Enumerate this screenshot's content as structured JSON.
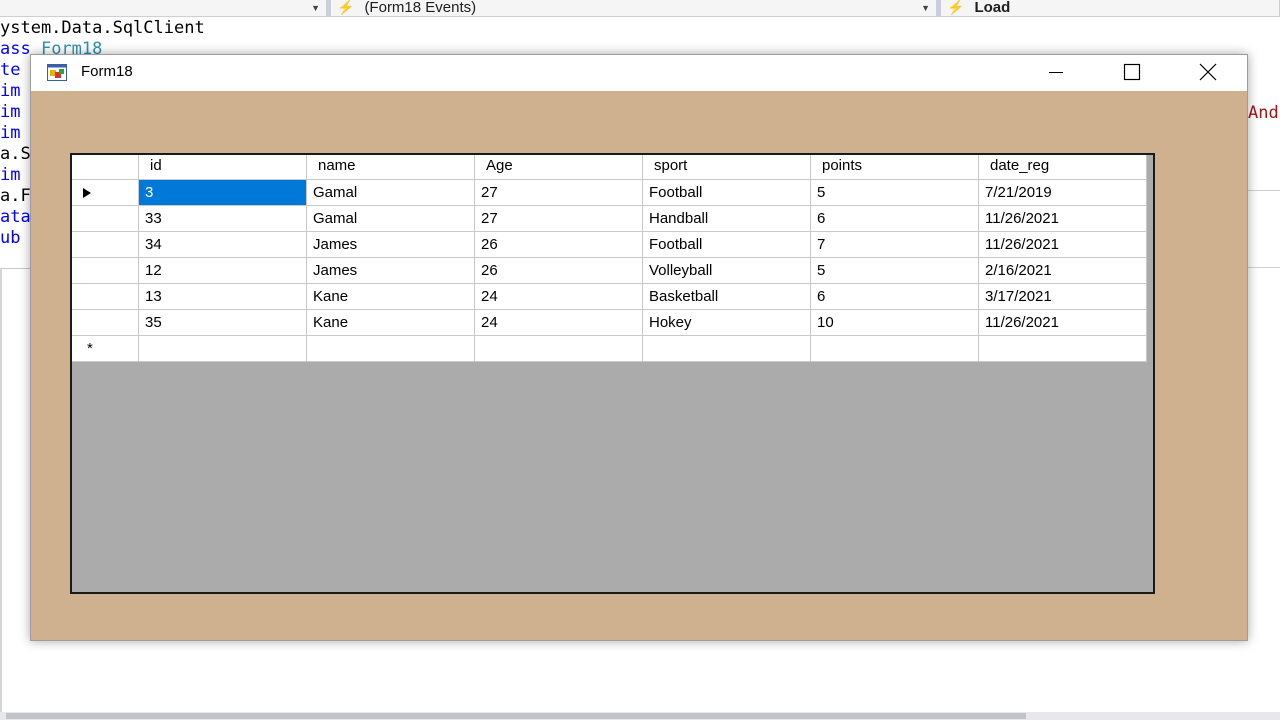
{
  "ide": {
    "member_dropdown": "(Form18 Events)",
    "event_dropdown": "Load",
    "code_lines": [
      [
        "ystem.Data.SqlClient"
      ],
      [
        "ass",
        " Form18"
      ],
      [
        "te"
      ],
      [
        "im"
      ],
      [
        "im"
      ],
      [
        "im"
      ],
      [
        "a.S"
      ],
      [
        "im"
      ],
      [
        "a.F"
      ],
      [
        "ata"
      ],
      [
        "ub"
      ]
    ],
    "code_right_fragment": "And"
  },
  "window": {
    "title": "Form18"
  },
  "grid": {
    "columns": [
      "id",
      "name",
      "Age",
      "sport",
      "points",
      "date_reg"
    ],
    "rows": [
      [
        "3",
        "Gamal",
        "27",
        "Football",
        "5",
        "7/21/2019"
      ],
      [
        "33",
        "Gamal",
        "27",
        "Handball",
        "6",
        "11/26/2021"
      ],
      [
        "34",
        "James",
        "26",
        "Football",
        "7",
        "11/26/2021"
      ],
      [
        "12",
        "James",
        "26",
        "Volleyball",
        "5",
        "2/16/2021"
      ],
      [
        "13",
        "Kane",
        "24",
        "Basketball",
        "6",
        "3/17/2021"
      ],
      [
        "35",
        "Kane",
        "24",
        "Hokey",
        "10",
        "11/26/2021"
      ]
    ],
    "new_row_marker": "*",
    "selected_row": 0,
    "selected_col": 0
  },
  "colors": {
    "form_background": "#cfb18f",
    "grid_background": "#ababab",
    "selection": "#0078d7"
  }
}
